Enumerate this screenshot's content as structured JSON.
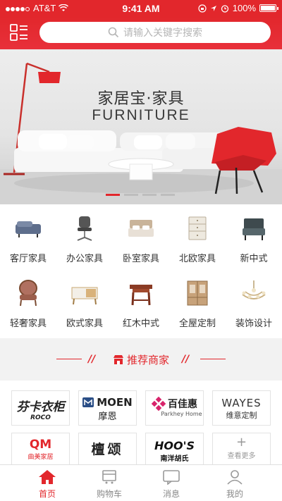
{
  "status_bar": {
    "carrier": "AT&T",
    "time": "9:41 AM",
    "battery": "100%"
  },
  "header": {
    "search_placeholder": "请输入关键字搜索"
  },
  "banner": {
    "title": "家居宝·家具",
    "subtitle": "FURNITURE"
  },
  "categories": [
    {
      "label": "客厅家具",
      "icon": "sofa-icon"
    },
    {
      "label": "办公家具",
      "icon": "office-chair-icon"
    },
    {
      "label": "卧室家具",
      "icon": "bed-icon"
    },
    {
      "label": "北欧家具",
      "icon": "cabinet-icon"
    },
    {
      "label": "新中式",
      "icon": "armchair-icon"
    },
    {
      "label": "轻奢家具",
      "icon": "luxury-chair-icon"
    },
    {
      "label": "欧式家具",
      "icon": "tv-stand-icon"
    },
    {
      "label": "红木中式",
      "icon": "rosewood-table-icon"
    },
    {
      "label": "全屋定制",
      "icon": "wardrobe-icon"
    },
    {
      "label": "装饰设计",
      "icon": "chandelier-icon"
    }
  ],
  "recommend": {
    "title": "推荐商家"
  },
  "brands": [
    {
      "name": "芬卡衣柜",
      "sub": "ROCO"
    },
    {
      "name": "MOEN",
      "sub": "摩恩"
    },
    {
      "name": "百佳惠",
      "sub": "Parkhey Home"
    },
    {
      "name": "WAYES",
      "sub": "维意定制"
    },
    {
      "name": "QM",
      "sub": "曲美家居"
    },
    {
      "name": "檀颂",
      "sub": ""
    },
    {
      "name": "HOO'S",
      "sub": "南洋胡氏"
    },
    {
      "name": "+",
      "sub": "查看更多"
    }
  ],
  "tabbar": [
    {
      "label": "首页",
      "active": true
    },
    {
      "label": "购物车",
      "active": false
    },
    {
      "label": "消息",
      "active": false
    },
    {
      "label": "我的",
      "active": false
    }
  ],
  "colors": {
    "brand": "#e2272c"
  }
}
